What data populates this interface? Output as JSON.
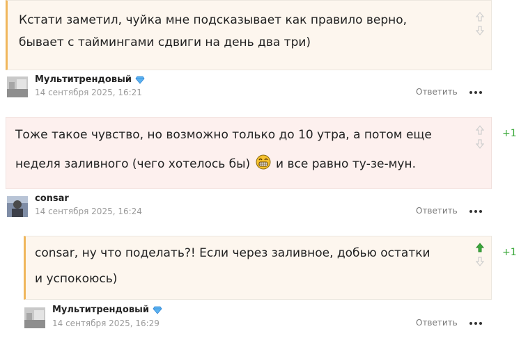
{
  "comments": [
    {
      "text_line1": "Кстати заметил, чуйка мне подсказывает как правило верно,",
      "text_line2": "бывает с таймингами сдвиги на день два три)",
      "author": "Мультитрендовый",
      "author_badge": "diamond-icon",
      "timestamp": "14 сентября 2025, 16:21",
      "reply_label": "Ответить",
      "score": ""
    },
    {
      "text_line1": "Тоже такое чувство, но возможно только до 10 утра, а потом еще",
      "text_line2_before": "неделя заливного (чего хотелось бы)",
      "text_line2_emoji": "grinning-smiley-icon",
      "text_line2_after": "и все равно ту-зе-мун.",
      "author": "consar",
      "timestamp": "14 сентября 2025, 16:24",
      "reply_label": "Ответить",
      "score": "+1"
    },
    {
      "text_line1": "consar, ну что поделать?! Если через заливное, добью остатки",
      "text_line2": "и успокоюсь)",
      "author": "Мультитрендовый",
      "author_badge": "diamond-icon",
      "timestamp": "14 сентября 2025, 16:29",
      "reply_label": "Ответить",
      "score": "+1",
      "upvoted": true
    }
  ],
  "colors": {
    "bar_accent": "#f0b75c",
    "box_bg": "#fdf6ee",
    "box_bg_pink": "#fdf0ee",
    "score_green": "#3aa83a",
    "upvote_active": "#3aa83a",
    "arrow_inactive": "#cfcfcf"
  }
}
